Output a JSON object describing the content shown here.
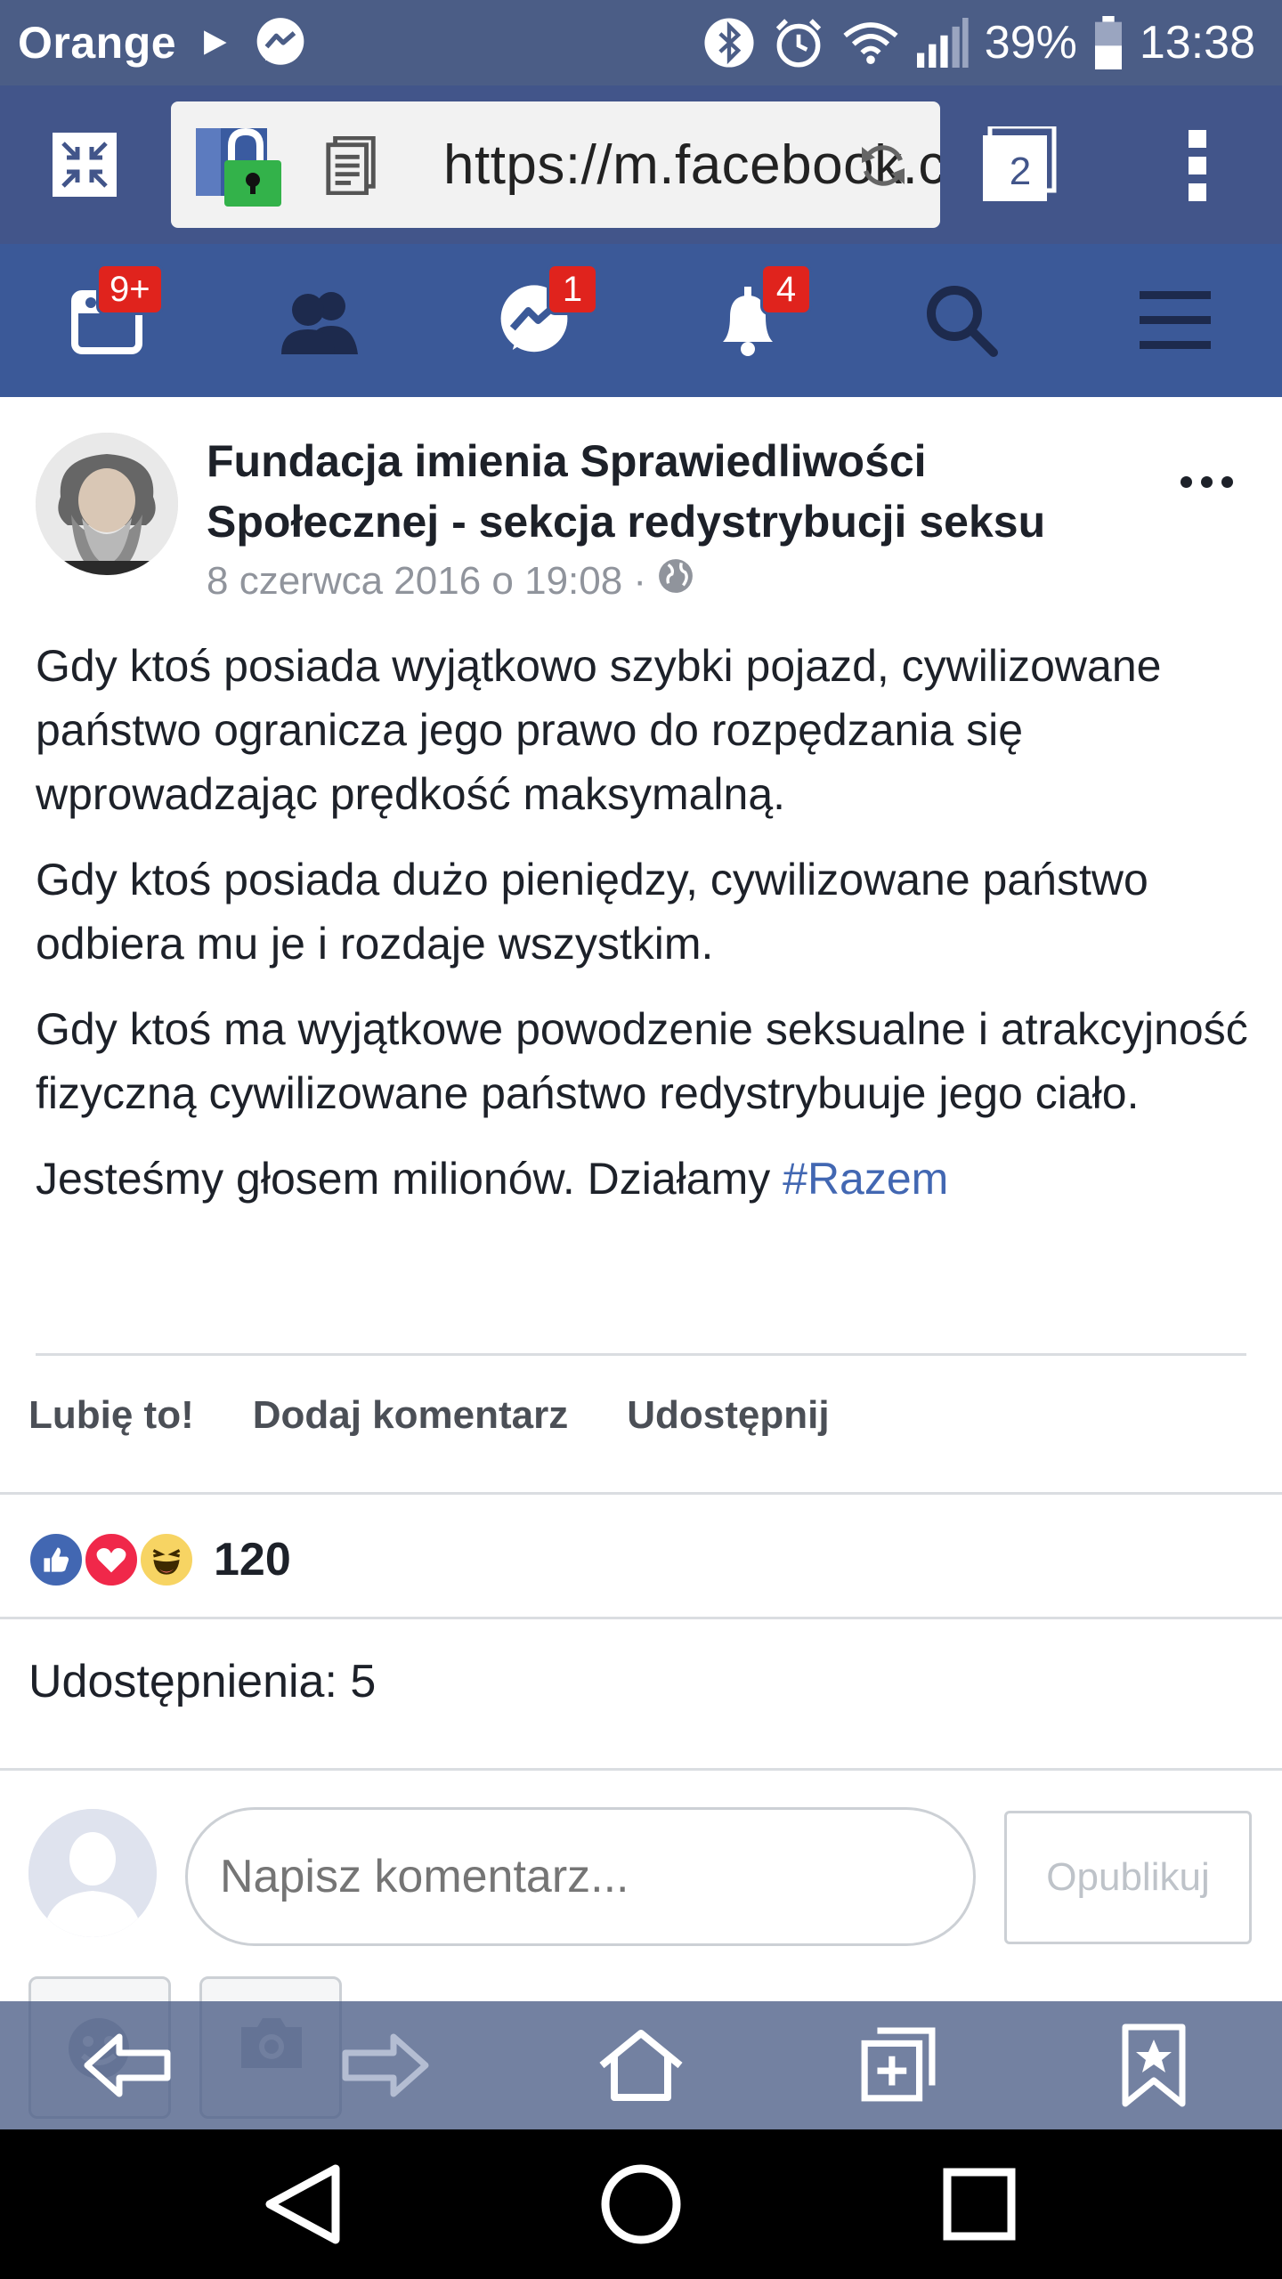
{
  "status_bar": {
    "carrier": "Orange",
    "battery": "39%",
    "time": "13:38",
    "icons": [
      "play-icon",
      "messenger-icon",
      "bluetooth-icon",
      "alarm-icon",
      "wifi-icon",
      "signal-icon",
      "battery-icon"
    ]
  },
  "browser": {
    "url": "https://m.facebook.com",
    "tab_count": "2",
    "icons": [
      "shrink-icon",
      "lock-icon",
      "reader-icon",
      "reload-icon",
      "tabs-icon",
      "menu-dots-icon"
    ]
  },
  "fb_nav": {
    "news_badge": "9+",
    "messages_badge": "1",
    "notifications_badge": "4",
    "icons": [
      "news-feed-icon",
      "friends-icon",
      "messenger-icon",
      "bell-icon",
      "search-icon",
      "hamburger-icon"
    ]
  },
  "post": {
    "author": "Fundacja imienia Sprawiedliwości Społecznej - sekcja redystrybucji seksu",
    "timestamp": "8 czerwca 2016 o 19:08 ·",
    "paragraphs": [
      "Gdy ktoś posiada wyjątkowo szybki pojazd, cywilizowane państwo ogranicza jego prawo do rozpędzania się wprowadzając prędkość maksymalną.",
      "Gdy ktoś posiada dużo pieniędzy, cywilizowane państwo odbiera mu je i rozdaje wszystkim.",
      "Gdy ktoś ma wyjątkowe powodzenie seksualne i atrakcyjność fizyczną cywilizowane państwo redystrybuuje jego ciało."
    ],
    "last_line": "Jesteśmy głosem milionów. Działamy ",
    "hashtag": "#Razem",
    "actions": {
      "like": "Lubię to!",
      "comment": "Dodaj komentarz",
      "share": "Udostępnij"
    },
    "reaction_count": "120",
    "shares": "Udostępnienia: 5"
  },
  "comment_box": {
    "placeholder": "Napisz komentarz...",
    "publish": "Opublikuj"
  },
  "colors": {
    "fb_blue": "#3b5998",
    "link": "#4267b2",
    "badge": "#e0231d",
    "status_bar": "#4b5d86"
  }
}
